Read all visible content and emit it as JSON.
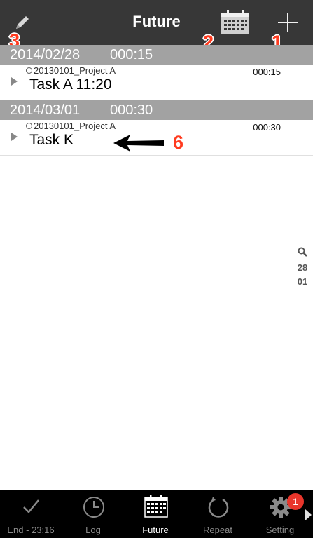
{
  "header": {
    "title": "Future",
    "edit_icon": "pencil-icon",
    "calendar_icon": "calendar-icon",
    "add_icon": "plus-icon"
  },
  "annotations": {
    "edit": "3",
    "calendar": "2",
    "add": "1",
    "task": "6"
  },
  "sections": [
    {
      "date": "2014/02/28",
      "duration": "000:15",
      "tasks": [
        {
          "project": "20130101_Project A",
          "duration": "000:15",
          "name": "Task A 11:20"
        }
      ]
    },
    {
      "date": "2014/03/01",
      "duration": "000:30",
      "tasks": [
        {
          "project": "20130101_Project A",
          "duration": "000:30",
          "name": "Task K"
        }
      ]
    }
  ],
  "side_index": {
    "icon": "search-icon",
    "items": [
      "28",
      "01"
    ]
  },
  "tabbar": {
    "tabs": [
      {
        "label": "End - 23:16",
        "icon": "checkmark-icon"
      },
      {
        "label": "Log",
        "icon": "clock-icon"
      },
      {
        "label": "Future",
        "icon": "calendar-icon",
        "active": true
      },
      {
        "label": "Repeat",
        "icon": "repeat-icon"
      },
      {
        "label": "Setting",
        "icon": "gear-icon"
      }
    ],
    "setting_badge": "1",
    "more_icon": "chevron-right-icon"
  },
  "colors": {
    "topbar": "#373737",
    "section_header": "#a2a2a2",
    "annotation": "#ff3b1f",
    "badge": "#e8352b",
    "tab_inactive": "#8a8a8a",
    "tab_active": "#ffffff"
  }
}
